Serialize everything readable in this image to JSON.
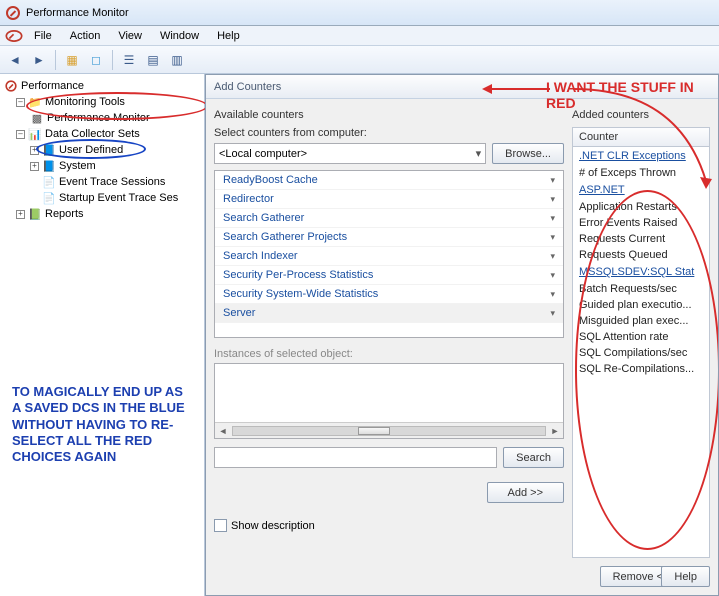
{
  "window": {
    "title": "Performance Monitor"
  },
  "menu": {
    "file": "File",
    "action": "Action",
    "view": "View",
    "window": "Window",
    "help": "Help"
  },
  "tree": {
    "root": "Performance",
    "monitoring": "Monitoring Tools",
    "perfmon": "Performance Monitor",
    "dcs": "Data Collector Sets",
    "userdef": "User Defined",
    "system": "System",
    "ets": "Event Trace Sessions",
    "sets": "Startup Event Trace Ses",
    "reports": "Reports"
  },
  "note_text": "TO MAGICALLY END UP AS A SAVED DCS IN THE BLUE WITHOUT HAVING TO RE-SELECT ALL THE RED CHOICES AGAIN",
  "dialog": {
    "title": "Add Counters",
    "annotation": "I WANT THE STUFF IN RED",
    "avail_label": "Available counters",
    "select_label": "Select counters from computer:",
    "computer": "<Local computer>",
    "browse": "Browse...",
    "counters": [
      "ReadyBoost Cache",
      "Redirector",
      "Search Gatherer",
      "Search Gatherer Projects",
      "Search Indexer",
      "Security Per-Process Statistics",
      "Security System-Wide Statistics",
      "Server"
    ],
    "inst_label": "Instances of selected object:",
    "search": "Search",
    "add": "Add >>",
    "showdesc": "Show description",
    "added_label": "Added counters",
    "col_counter": "Counter",
    "groups": [
      {
        "name": ".NET CLR Exceptions",
        "items": [
          "# of Exceps Thrown"
        ]
      },
      {
        "name": "ASP.NET",
        "items": [
          "Application Restarts",
          "Error Events Raised",
          "Requests Current",
          "Requests Queued"
        ]
      },
      {
        "name": "MSSQLSDEV:SQL Stat",
        "items": [
          "Batch Requests/sec",
          "Guided plan executio...",
          "Misguided plan exec...",
          "SQL Attention rate",
          "SQL Compilations/sec",
          "SQL Re-Compilations..."
        ]
      }
    ],
    "remove": "Remove <<",
    "help": "Help"
  }
}
